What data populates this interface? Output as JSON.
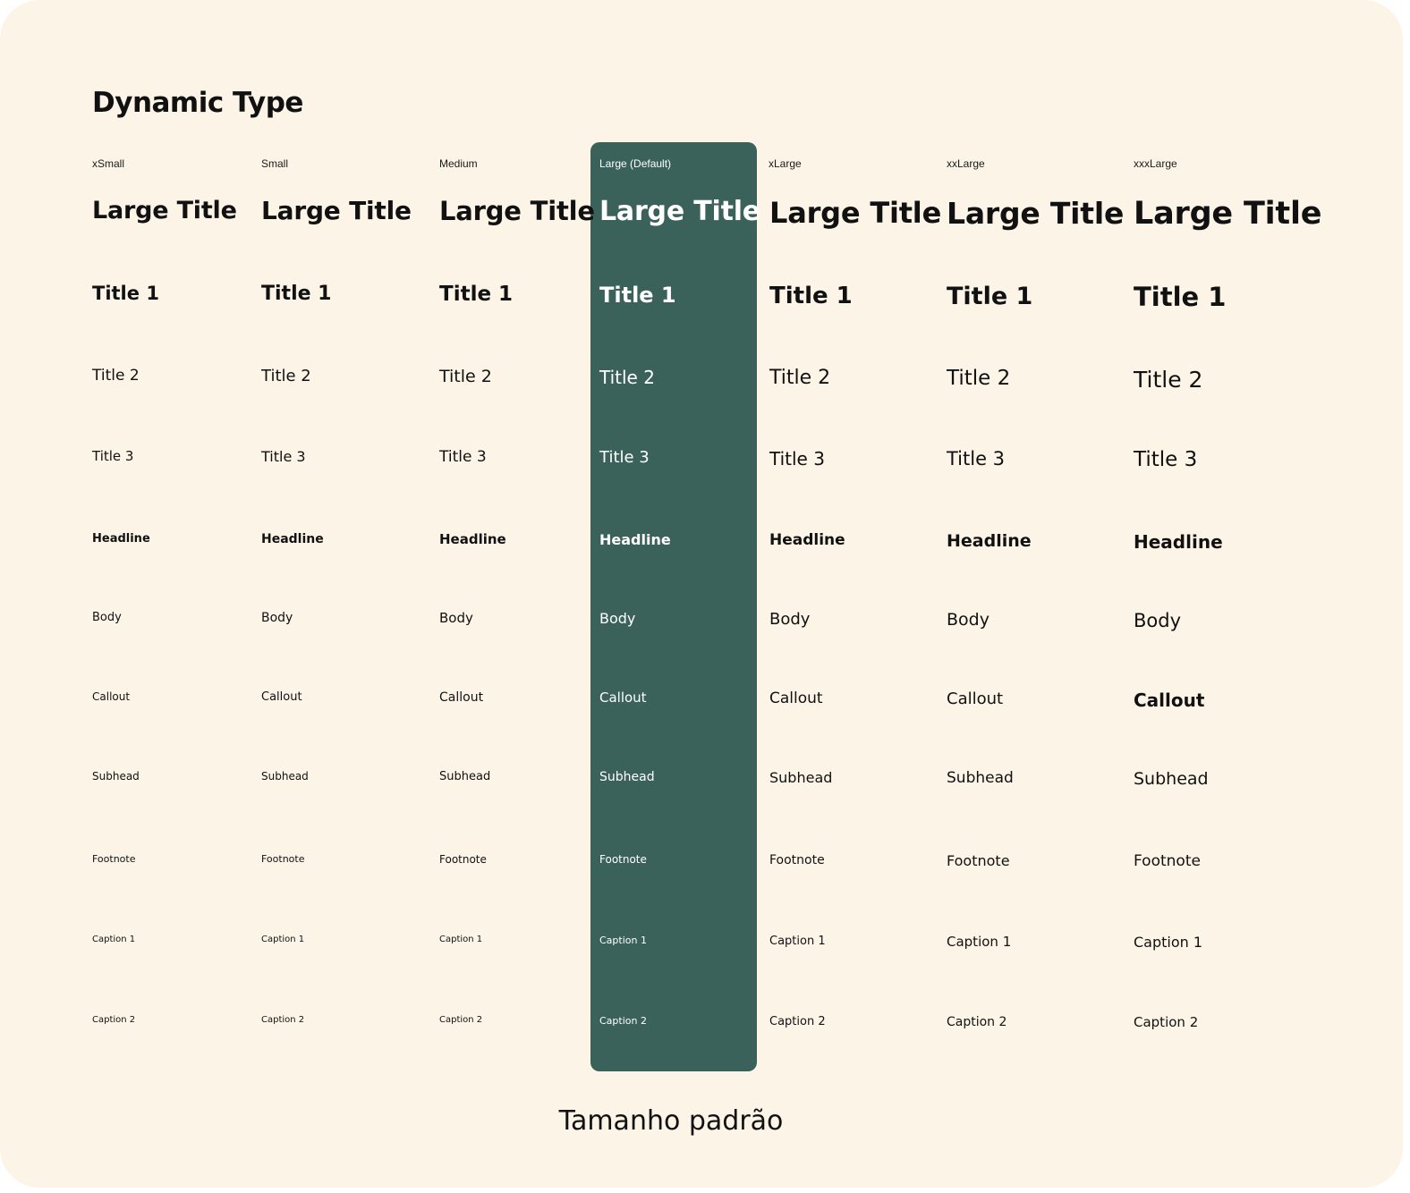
{
  "title": "Dynamic Type",
  "footer_label": "Tamanho padrão",
  "highlight_color": "#3b625a",
  "background_color": "#fdf4e8",
  "row_names": [
    "Large Title",
    "Title 1",
    "Title 2",
    "Title 3",
    "Headline",
    "Body",
    "Callout",
    "Subhead",
    "Footnote",
    "Caption 1",
    "Caption 2"
  ],
  "columns": [
    {
      "size": "xSmall",
      "rows": [
        "Large Title",
        "Title 1",
        "Title 2",
        "Title 3",
        "Headline",
        "Body",
        "Callout",
        "Subhead",
        "Footnote",
        "Caption 1",
        "Caption 2"
      ]
    },
    {
      "size": "Small",
      "rows": [
        "Large Title",
        "Title 1",
        "Title 2",
        "Title 3",
        "Headline",
        "Body",
        "Callout",
        "Subhead",
        "Footnote",
        "Caption 1",
        "Caption 2"
      ]
    },
    {
      "size": "Medium",
      "rows": [
        "Large Title",
        "Title 1",
        "Title 2",
        "Title 3",
        "Headline",
        "Body",
        "Callout",
        "Subhead",
        "Footnote",
        "Caption 1",
        "Caption 2"
      ]
    },
    {
      "size": "Large (Default)",
      "rows": [
        "Large Title",
        "Title 1",
        "Title 2",
        "Title 3",
        "Headline",
        "Body",
        "Callout",
        "Subhead",
        "Footnote",
        "Caption 1",
        "Caption 2"
      ]
    },
    {
      "size": "xLarge",
      "rows": [
        "Large Title",
        "Title 1",
        "Title 2",
        "Title 3",
        "Headline",
        "Body",
        "Callout",
        "Subhead",
        "Footnote",
        "Caption 1",
        "Caption 2"
      ]
    },
    {
      "size": "xxLarge",
      "rows": [
        "Large Title",
        "Title 1",
        "Title 2",
        "Title 3",
        "Headline",
        "Body",
        "Callout",
        "Subhead",
        "Footnote",
        "Caption 1",
        "Caption 2"
      ]
    },
    {
      "size": "xxxLarge",
      "rows": [
        "Large Title",
        "Title 1",
        "Title 2",
        "Title 3",
        "Headline",
        "Body",
        "Callout",
        "Subhead",
        "Footnote",
        "Caption 1",
        "Caption 2"
      ]
    }
  ]
}
